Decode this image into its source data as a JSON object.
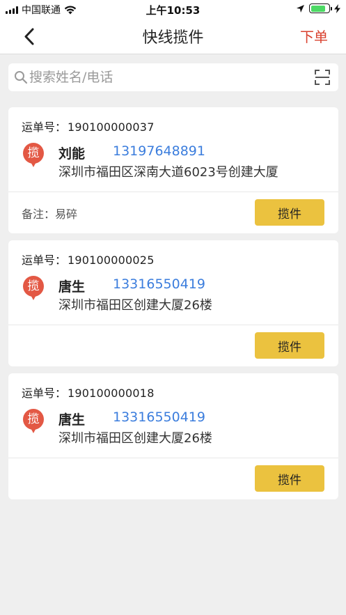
{
  "status_bar": {
    "carrier": "中国联通",
    "time": "上午10:53",
    "battery_level": 0.8
  },
  "nav": {
    "title": "快线揽件",
    "action": "下单"
  },
  "search": {
    "placeholder": "搜索姓名/电话"
  },
  "waybill_label": "运单号：",
  "orders": [
    {
      "waybill_no": "190100000037",
      "badge": "揽",
      "name": "刘能",
      "phone": "13197648891",
      "address": "深圳市福田区深南大道6023号创建大厦",
      "remark": "备注：易碎",
      "button": "揽件"
    },
    {
      "waybill_no": "190100000025",
      "badge": "揽",
      "name": "唐生",
      "phone": "13316550419",
      "address": "深圳市福田区创建大厦26楼",
      "remark": "",
      "button": "揽件"
    },
    {
      "waybill_no": "190100000018",
      "badge": "揽",
      "name": "唐生",
      "phone": "13316550419",
      "address": "深圳市福田区创建大厦26楼",
      "remark": "",
      "button": "揽件"
    }
  ],
  "colors": {
    "accent_red": "#d9402e",
    "button_yellow": "#ebc23f",
    "phone_blue": "#3b7ddd",
    "pin_red": "#e35844"
  },
  "icons": {
    "back": "chevron-left-icon",
    "search": "search-icon",
    "scan": "scan-icon",
    "location": "location-arrow-icon",
    "wifi": "wifi-icon",
    "battery": "battery-icon",
    "charging": "charging-bolt-icon"
  }
}
